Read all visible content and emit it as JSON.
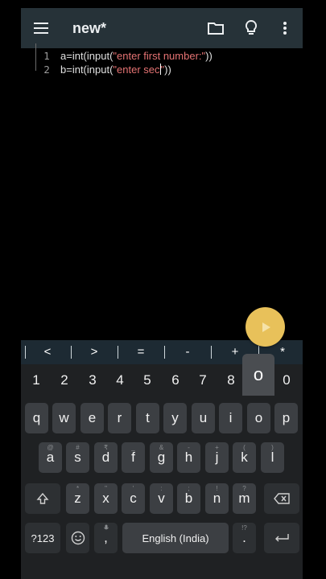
{
  "toolbar": {
    "title": "new*",
    "icons": [
      "menu-icon",
      "folder-icon",
      "lightbulb-icon",
      "more-vert-icon"
    ]
  },
  "editor": {
    "lines": [
      {
        "num": "1",
        "code_pre": "a=int(input(",
        "string": "\"enter first number:\"",
        "code_post": "))"
      },
      {
        "num": "2",
        "code_pre": "b=int(input(",
        "string_before_cursor": "\"enter sec",
        "string_after_cursor": "\"",
        "code_post": "))"
      }
    ]
  },
  "run_button": {
    "icon": "play-icon"
  },
  "symbol_bar": [
    "<",
    ">",
    "=",
    "-",
    "+",
    "*"
  ],
  "keyboard": {
    "numbers": [
      "1",
      "2",
      "3",
      "4",
      "5",
      "6",
      "7",
      "8",
      "9",
      "0"
    ],
    "row1": [
      "q",
      "w",
      "e",
      "r",
      "t",
      "y",
      "u",
      "i",
      "o",
      "p"
    ],
    "row2": [
      "a",
      "s",
      "d",
      "f",
      "g",
      "h",
      "j",
      "k",
      "l"
    ],
    "row2_hints": [
      "@",
      "#",
      "₹",
      "_",
      "&",
      "-",
      "+",
      "(",
      ")"
    ],
    "row3": [
      "z",
      "x",
      "c",
      "v",
      "b",
      "n",
      "m"
    ],
    "row3_hints": [
      "*",
      "\"",
      "'",
      ":",
      ";",
      "!",
      "?"
    ],
    "popup_key": "o",
    "symbols_key": "?123",
    "comma": ",",
    "space_label": "English (India)",
    "period": ".",
    "period_hint": "!?"
  },
  "colors": {
    "toolbar": "#263238",
    "fab": "#e8c15a",
    "string": "#e57373",
    "keyboard": "#1f2123"
  }
}
